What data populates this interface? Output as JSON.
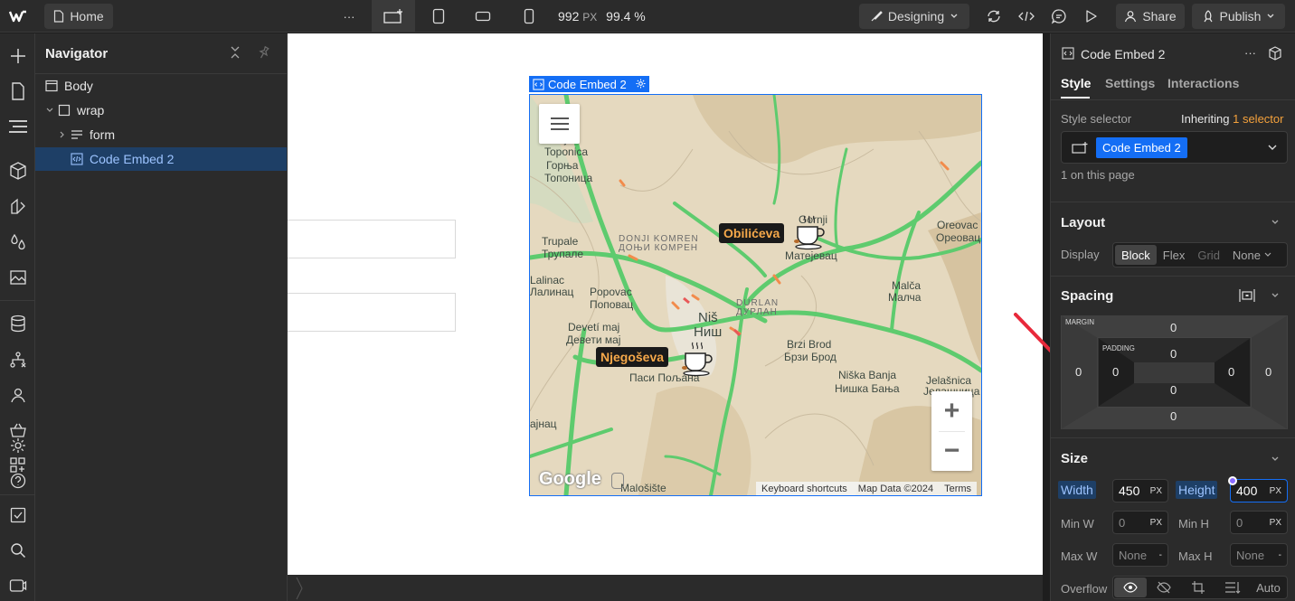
{
  "topbar": {
    "home_label": "Home",
    "more": "···",
    "canvas_width": "992",
    "width_unit": "PX",
    "zoom": "99.4 %",
    "mode_label": "Designing",
    "share_label": "Share",
    "publish_label": "Publish"
  },
  "navigator": {
    "title": "Navigator",
    "items": [
      {
        "label": "Body"
      },
      {
        "label": "wrap"
      },
      {
        "label": "form"
      },
      {
        "label": "Code Embed 2"
      }
    ]
  },
  "canvas": {
    "selected_label": "Code Embed 2"
  },
  "map": {
    "markers": [
      {
        "label": "Obilićeva"
      },
      {
        "label": "Njegoševa"
      }
    ],
    "places": [
      "Donja",
      "Toponica",
      "Горња",
      "Топоница",
      "DONJI KOMREN",
      "ДОЊИ КОМРЕН",
      "Trupale",
      "Трупале",
      "Lalinac",
      "Лалинац",
      "Popovac",
      "Поповац",
      "Devetí maj",
      "Девети мај",
      "Niš",
      "Ниш",
      "DURLAN",
      "ДУРЛАН",
      "Brzi Brod",
      "Брзи Брод",
      "Niška Banja",
      "Нишка Бања",
      "Jelašnica",
      "Јелашница",
      "Oreovac",
      "Ореовац",
      "Malča",
      "Малча",
      "Gornji",
      "Матејевац",
      "Паси Пољана",
      "Malošište",
      "ајнац"
    ],
    "logo": "Google",
    "attribution": [
      "Keyboard shortcuts",
      "Map Data ©2024",
      "Terms"
    ],
    "zoom_in": "+",
    "zoom_out": "−"
  },
  "right": {
    "element_title": "Code Embed 2",
    "more": "···",
    "tabs": [
      "Style",
      "Settings",
      "Interactions"
    ],
    "style_selector_label": "Style selector",
    "inheriting": "Inheriting",
    "inheriting_count": "1 selector",
    "selector_chip": "Code Embed 2",
    "on_page": "1 on this page",
    "layout": {
      "title": "Layout",
      "display_label": "Display",
      "options": [
        "Block",
        "Flex",
        "Grid",
        "None"
      ]
    },
    "spacing": {
      "title": "Spacing",
      "margin_label": "MARGIN",
      "padding_label": "PADDING",
      "margin": {
        "top": "0",
        "right": "0",
        "bottom": "0",
        "left": "0"
      },
      "padding": {
        "top": "0",
        "right": "0",
        "bottom": "0",
        "left": "0"
      }
    },
    "size": {
      "title": "Size",
      "width_label": "Width",
      "width_value": "450",
      "height_label": "Height",
      "height_value": "400",
      "unit": "PX",
      "minw_label": "Min W",
      "minw_value": "0",
      "minh_label": "Min H",
      "minh_value": "0",
      "maxw_label": "Max W",
      "maxw_value": "None",
      "maxh_label": "Max H",
      "maxh_value": "None",
      "dash": "-",
      "overflow_label": "Overflow",
      "overflow_auto": "Auto"
    }
  },
  "colors": {
    "accent": "#146ef5",
    "annotation_arrow": "#e8293b",
    "canvas_bg": "#ffffff",
    "panel_bg": "#2b2b2b"
  }
}
